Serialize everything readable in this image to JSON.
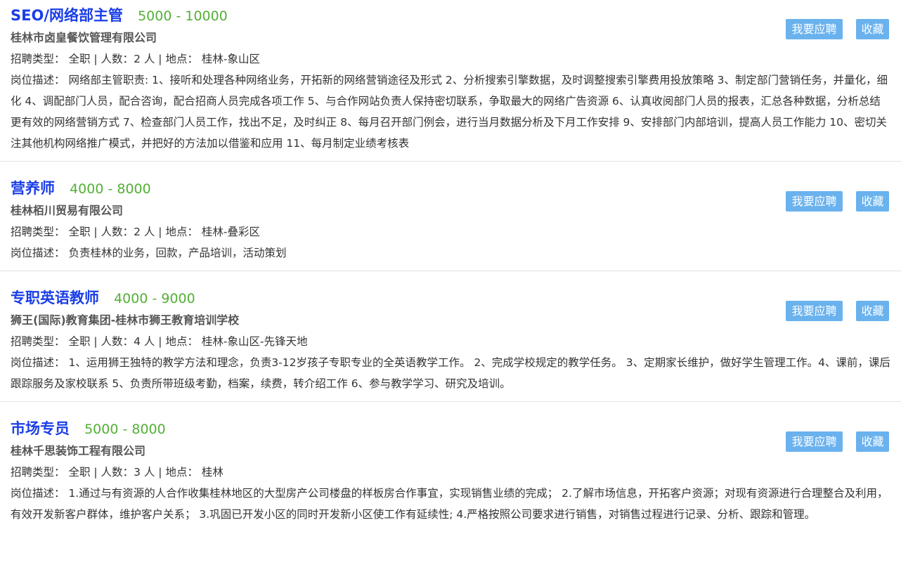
{
  "labels": {
    "apply": "我要应聘",
    "favorite": "收藏",
    "type": "招聘类型：",
    "count": "人数：",
    "location": "地点：",
    "desc": "岗位描述："
  },
  "jobs": [
    {
      "title": "SEO/网络部主管",
      "salary": "5000 - 10000",
      "company": "桂林市卤皇餐饮管理有限公司",
      "type": "全职",
      "count": "2 人",
      "location": "桂林-象山区",
      "description": "网络部主管职责: 1、接听和处理各种网络业务，开拓新的网络营销途径及形式 2、分析搜索引擎数据，及时调整搜索引擎费用投放策略 3、制定部门营销任务，并量化，细化 4、调配部门人员，配合咨询，配合招商人员完成各项工作 5、与合作网站负责人保持密切联系，争取最大的网络广告资源 6、认真收阅部门人员的报表，汇总各种数据，分析总结更有效的网络营销方式 7、检查部门人员工作，找出不足，及时纠正 8、每月召开部门例会，进行当月数据分析及下月工作安排 9、安排部门内部培训，提高人员工作能力 10、密切关注其他机构网络推广模式，并把好的方法加以借鉴和应用 11、每月制定业绩考核表"
    },
    {
      "title": "营养师",
      "salary": "4000 - 8000",
      "company": "桂林栢川贸易有限公司",
      "type": "全职",
      "count": "2 人",
      "location": "桂林-叠彩区",
      "description": "负责桂林的业务，回款，产品培训，活动策划"
    },
    {
      "title": "专职英语教师",
      "salary": "4000 - 9000",
      "company": "狮王(国际)教育集团-桂林市狮王教育培训学校",
      "type": "全职",
      "count": "4 人",
      "location": "桂林-象山区-先锋天地",
      "description": "1、运用狮王独特的教学方法和理念，负责3-12岁孩子专职专业的全英语教学工作。 2、完成学校规定的教学任务。 3、定期家长维护，做好学生管理工作。4、课前，课后跟踪服务及家校联系 5、负责所带班级考勤，档案，续费，转介绍工作 6、参与教学学习、研究及培训。"
    },
    {
      "title": "市场专员",
      "salary": "5000 - 8000",
      "company": "桂林千思装饰工程有限公司",
      "type": "全职",
      "count": "3 人",
      "location": "桂林",
      "description": "1.通过与有资源的人合作收集桂林地区的大型房产公司楼盘的样板房合作事宜，实现销售业绩的完成； 2.了解市场信息，开拓客户资源；对现有资源进行合理整合及利用，有效开发新客户群体，维护客户关系； 3.巩固已开发小区的同时开发新小区使工作有延续性; 4.严格按照公司要求进行销售，对销售过程进行记录、分析、跟踪和管理。"
    }
  ]
}
